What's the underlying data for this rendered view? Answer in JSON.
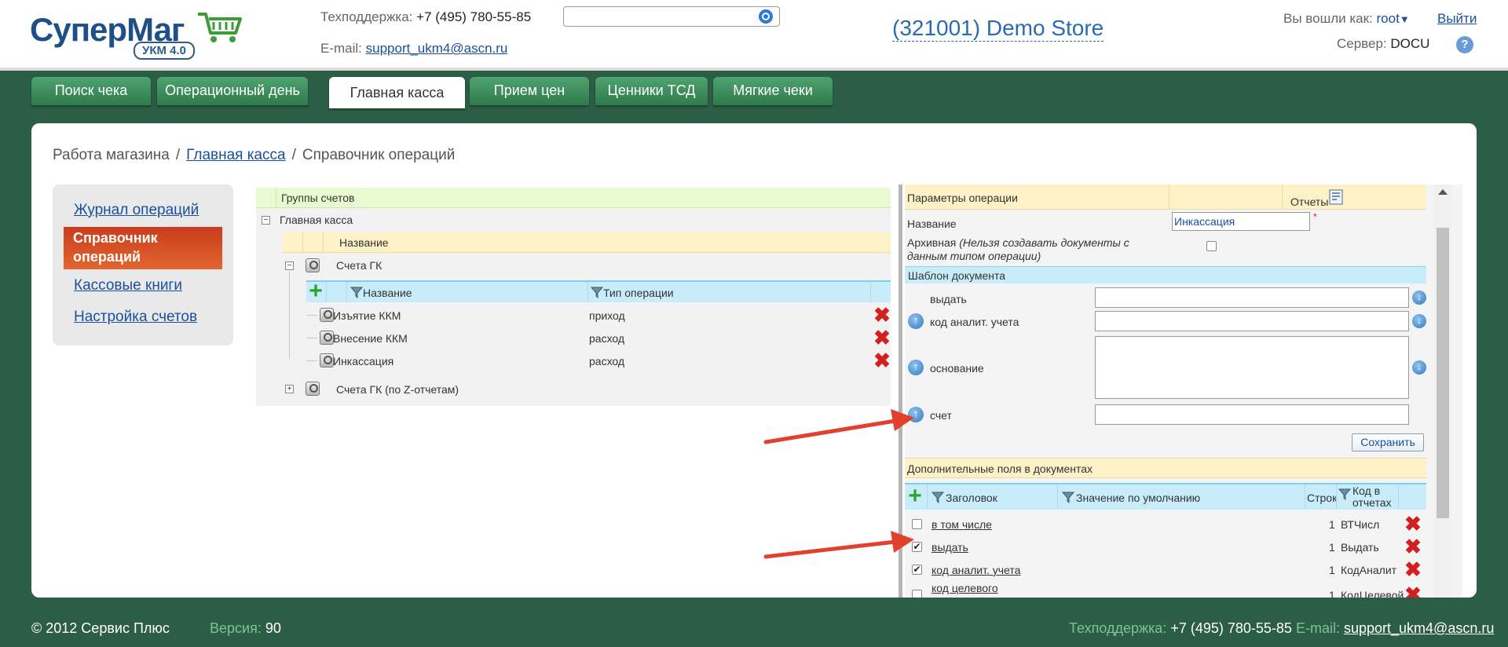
{
  "header": {
    "logo_main": "Супер",
    "logo_accent": "Маг",
    "logo_badge": "УКМ 4.0",
    "support_label": "Техподдержка:",
    "support_phone": "+7 (495) 780-55-85",
    "email_label": "E-mail:",
    "email": "support_ukm4@ascn.ru",
    "search_value": "",
    "store": "(321001) Demo Store",
    "login_label": "Вы вошли как:",
    "user": "root",
    "exit": "Выйти",
    "server_label": "Сервер:",
    "server": "DOCU"
  },
  "tabs": [
    {
      "label": "Поиск чека"
    },
    {
      "label": "Операционный день"
    },
    {
      "label": "Главная касса"
    },
    {
      "label": "Прием цен"
    },
    {
      "label": "Ценники ТСД"
    },
    {
      "label": "Мягкие чеки"
    }
  ],
  "breadcrumb": {
    "root": "Работа магазина",
    "sep": "/",
    "link": "Главная касса",
    "current": "Справочник операций"
  },
  "leftnav": [
    {
      "label": "Журнал операций"
    },
    {
      "label": "Справочник операций"
    },
    {
      "label": "Кассовые книги"
    },
    {
      "label": "Настройка счетов"
    }
  ],
  "tree": {
    "groups_header": "Группы счетов",
    "root": "Главная касса",
    "name_header": "Название",
    "node1": "Счета ГК",
    "col_name": "Название",
    "col_type": "Тип операции",
    "rows": [
      {
        "name": "Изъятие ККМ",
        "type": "приход"
      },
      {
        "name": "Внесение ККМ",
        "type": "расход"
      },
      {
        "name": "Инкассация",
        "type": "расход"
      }
    ],
    "node2": "Счета ГК (по Z-отчетам)"
  },
  "params": {
    "header": "Параметры операции",
    "reports": "Отчеты",
    "name_label": "Название",
    "name_value": "Инкассация",
    "required_mark": "*",
    "archive_label": "Архивная",
    "archive_note": "(Нельзя создавать документы с данным типом операции)",
    "template_header": "Шаблон документа",
    "fields": [
      {
        "label": "выдать",
        "value": ""
      },
      {
        "label": "код аналит. учета",
        "value": ""
      },
      {
        "label": "основание",
        "value": ""
      },
      {
        "label": "счет",
        "value": ""
      }
    ],
    "save": "Сохранить",
    "extra_header": "Дополнительные поля в документах",
    "col_title": "Заголовок",
    "col_default": "Значение по умолчанию",
    "col_rows": "Строк",
    "col_code": "Код в отчетах",
    "extra_rows": [
      {
        "title": "в том числе",
        "rows": "1",
        "code": "ВТЧисл",
        "checked": false
      },
      {
        "title": "выдать",
        "rows": "1",
        "code": "Выдать",
        "checked": true
      },
      {
        "title": "код аналит. учета",
        "rows": "1",
        "code": "КодАналит",
        "checked": true
      },
      {
        "title": "код целевого назначения",
        "rows": "1",
        "code": "КодЦелевой",
        "checked": false
      }
    ]
  },
  "footer": {
    "copyright": "© 2012 Сервис Плюс",
    "version_label": "Версия:",
    "version": "90",
    "support_label": "Техподдержка:",
    "support_phone": "+7 (495) 780-55-85",
    "email_label": "E-mail:",
    "email": "support_ukm4@ascn.ru"
  },
  "colors": {
    "background": "#2c5e47",
    "accent_orange": "#d8501f",
    "link_blue": "#1a4f9c",
    "tab_green": "#3e8f5c"
  },
  "icons": [
    "search-icon",
    "cart-icon",
    "help-icon",
    "magnifier-icon",
    "delete-icon",
    "add-icon",
    "filter-icon",
    "report-icon",
    "arrow-up-icon",
    "arrow-down-icon"
  ]
}
